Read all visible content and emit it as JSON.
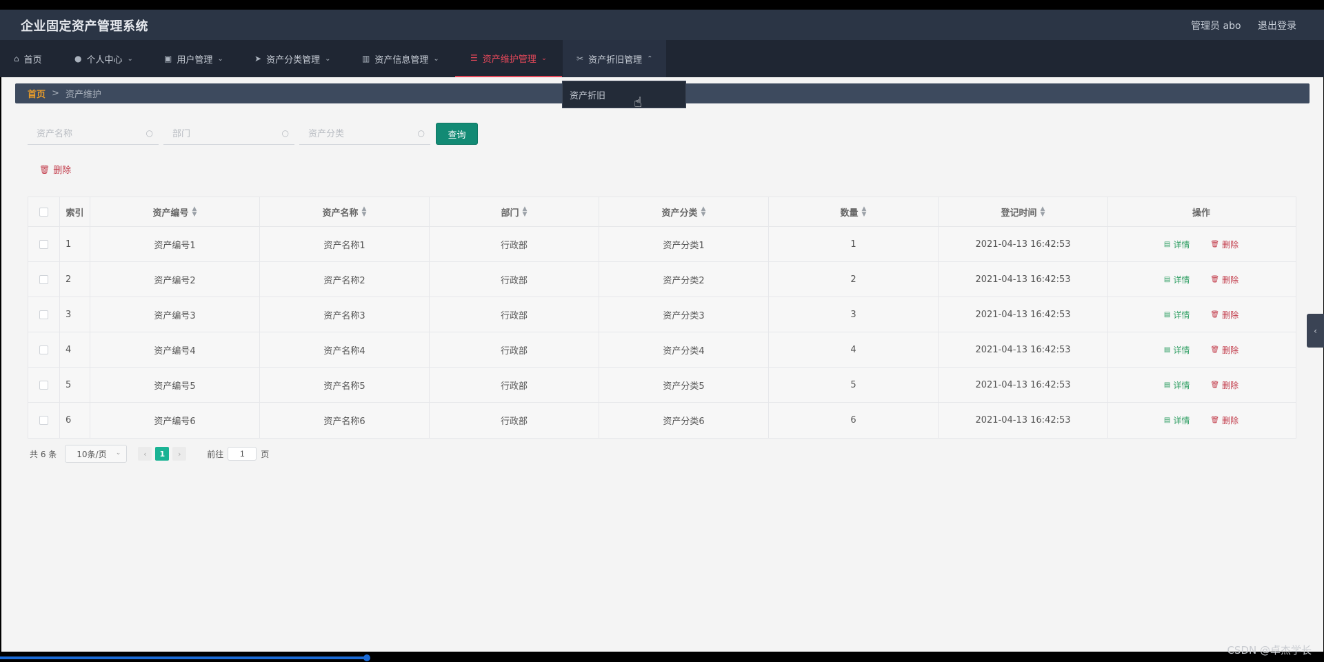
{
  "app": {
    "title": "企业固定资产管理系统"
  },
  "header": {
    "user_label": "管理员 abo",
    "logout_label": "退出登录"
  },
  "nav": {
    "items": [
      {
        "label": "首页",
        "icon": "home-icon"
      },
      {
        "label": "个人中心",
        "icon": "user-icon"
      },
      {
        "label": "用户管理",
        "icon": "chart-icon"
      },
      {
        "label": "资产分类管理",
        "icon": "send-icon"
      },
      {
        "label": "资产信息管理",
        "icon": "bar-chart-icon"
      },
      {
        "label": "资产维护管理",
        "icon": "list-icon",
        "active": true
      },
      {
        "label": "资产折旧管理",
        "icon": "ticket-icon",
        "open": true
      }
    ],
    "dropdown_item": "资产折旧"
  },
  "breadcrumb": {
    "home": "首页",
    "separator": ">",
    "current": "资产维护"
  },
  "search": {
    "name_placeholder": "资产名称",
    "dept_placeholder": "部门",
    "category_placeholder": "资产分类",
    "query_label": "查询"
  },
  "toolbar": {
    "delete_label": "删除"
  },
  "table": {
    "columns": [
      "索引",
      "资产编号",
      "资产名称",
      "部门",
      "资产分类",
      "数量",
      "登记时间",
      "操作"
    ],
    "rows": [
      {
        "index": "1",
        "code": "资产编号1",
        "name": "资产名称1",
        "dept": "行政部",
        "category": "资产分类1",
        "qty": "1",
        "time": "2021-04-13 16:42:53"
      },
      {
        "index": "2",
        "code": "资产编号2",
        "name": "资产名称2",
        "dept": "行政部",
        "category": "资产分类2",
        "qty": "2",
        "time": "2021-04-13 16:42:53"
      },
      {
        "index": "3",
        "code": "资产编号3",
        "name": "资产名称3",
        "dept": "行政部",
        "category": "资产分类3",
        "qty": "3",
        "time": "2021-04-13 16:42:53"
      },
      {
        "index": "4",
        "code": "资产编号4",
        "name": "资产名称4",
        "dept": "行政部",
        "category": "资产分类4",
        "qty": "4",
        "time": "2021-04-13 16:42:53"
      },
      {
        "index": "5",
        "code": "资产编号5",
        "name": "资产名称5",
        "dept": "行政部",
        "category": "资产分类5",
        "qty": "5",
        "time": "2021-04-13 16:42:53"
      },
      {
        "index": "6",
        "code": "资产编号6",
        "name": "资产名称6",
        "dept": "行政部",
        "category": "资产分类6",
        "qty": "6",
        "time": "2021-04-13 16:42:53"
      }
    ],
    "detail_label": "详情",
    "delete_label": "删除"
  },
  "pager": {
    "total": "共 6 条",
    "page_size": "10条/页",
    "current_page": "1",
    "goto_label": "前往",
    "goto_value": "1",
    "page_unit": "页"
  },
  "watermark": "CSDN @卓杰学长",
  "colors": {
    "accent": "#128a74",
    "active_nav": "#e5485a",
    "danger": "#c23b4a",
    "success": "#2e9e62",
    "breadcrumb_home": "#e79b2a"
  }
}
